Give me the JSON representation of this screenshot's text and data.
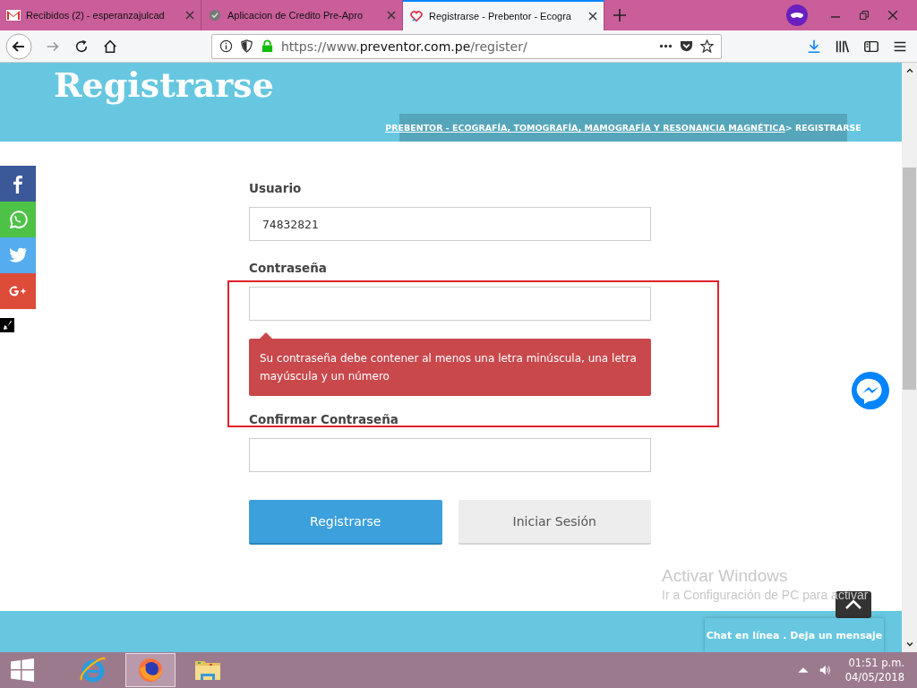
{
  "browser": {
    "tabs": [
      {
        "title": "Recibidos (2) - esperanzajulcad",
        "selected": false
      },
      {
        "title": "Aplicacion de Credito Pre-Apro",
        "selected": false
      },
      {
        "title": "Registrarse - Prebentor - Ecogra",
        "selected": true
      }
    ],
    "url": {
      "prefix": "https://www.",
      "domain": "preventor.com.pe",
      "path": "/register/"
    }
  },
  "page": {
    "title": "Registrarse",
    "breadcrumb": {
      "link": "PREBENTOR - ECOGRAFÍA, TOMOGRAFÍA, MAMOGRAFÍA Y RESONANCIA MAGNÉTICA",
      "separator": " > ",
      "current": "REGISTRARSE"
    },
    "fields": [
      {
        "label": "Usuario",
        "value": "74832821"
      },
      {
        "label": "Contraseña",
        "error": "Su contraseña debe contener al menos una letra minúscula, una letra mayúscula y un número"
      },
      {
        "label": "Confirmar Contraseña"
      }
    ],
    "buttons": [
      {
        "label": "Registrarse",
        "kind": "primary"
      },
      {
        "label": "Iniciar Sesión",
        "kind": "secondary"
      }
    ],
    "social": [
      {
        "kind": "facebook"
      },
      {
        "kind": "whatsapp"
      },
      {
        "kind": "twitter"
      },
      {
        "kind": "google"
      }
    ],
    "chat": "Chat en línea . Deja un mensaje"
  },
  "watermark": {
    "title": "Activar Windows",
    "text": "Ir a Configuración de PC para activar"
  },
  "taskbar": {
    "apps": [
      {
        "kind": "ie",
        "selected": false
      },
      {
        "kind": "firefox",
        "selected": true
      },
      {
        "kind": "folder",
        "selected": false
      }
    ],
    "time": "01:51 p.m.",
    "date": "04/05/2018"
  }
}
